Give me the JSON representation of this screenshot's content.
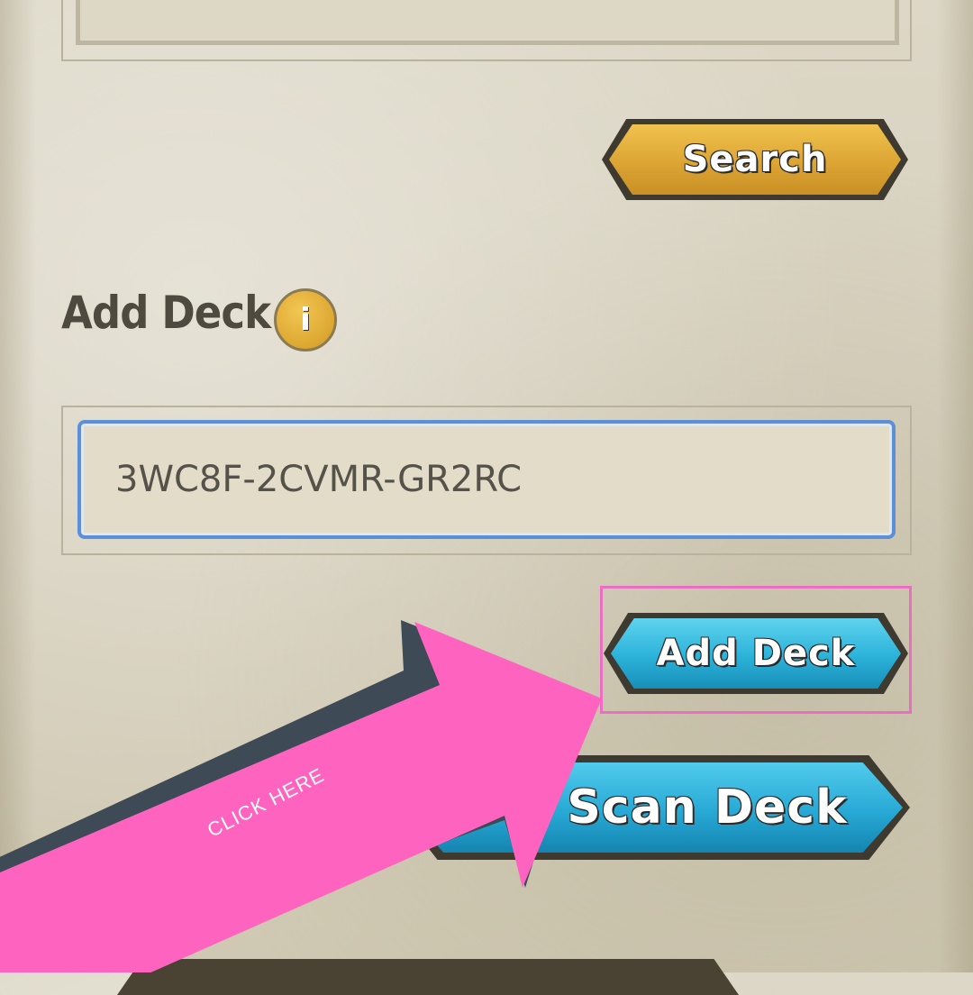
{
  "search": {
    "button_label": "Search"
  },
  "add_deck": {
    "title": "Add Deck",
    "info_icon_glyph": "i",
    "input_value": "3WC8F-2CVMR-GR2RC",
    "button_label": "Add Deck"
  },
  "scan": {
    "button_label": "Scan Deck"
  },
  "annotation": {
    "arrow_text": "CLICK HERE",
    "color": "#ff63c0"
  },
  "colors": {
    "gold": "#dca534",
    "cyan": "#2bb2d9",
    "input_border": "#5b8fd8"
  },
  "icons": [
    "info-icon",
    "arrow-annotation"
  ]
}
